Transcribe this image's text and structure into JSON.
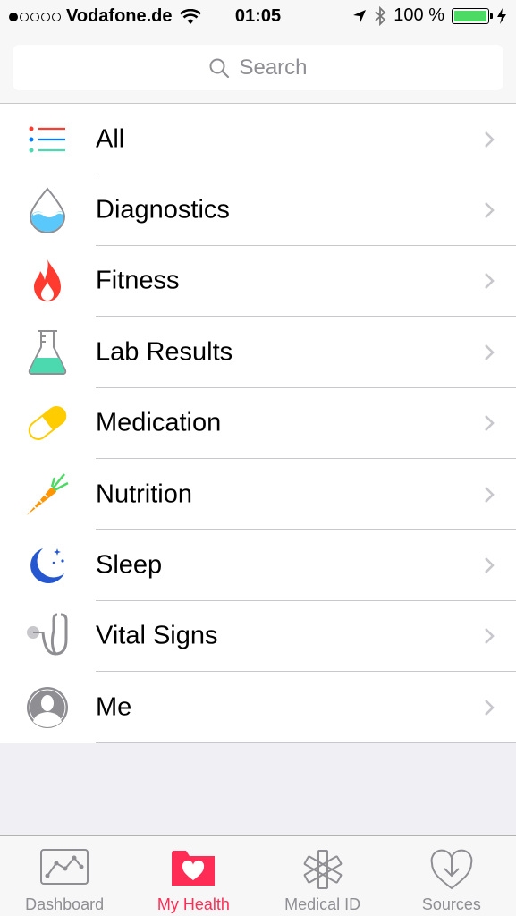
{
  "status_bar": {
    "carrier": "Vodafone.de",
    "time": "01:05",
    "battery_percent": "100 %",
    "signal_bars": 1
  },
  "search": {
    "placeholder": "Search"
  },
  "categories": [
    {
      "label": "All",
      "icon": "list-icon"
    },
    {
      "label": "Diagnostics",
      "icon": "drop-icon"
    },
    {
      "label": "Fitness",
      "icon": "flame-icon"
    },
    {
      "label": "Lab Results",
      "icon": "flask-icon"
    },
    {
      "label": "Medication",
      "icon": "pill-icon"
    },
    {
      "label": "Nutrition",
      "icon": "carrot-icon"
    },
    {
      "label": "Sleep",
      "icon": "moon-icon"
    },
    {
      "label": "Vital Signs",
      "icon": "stethoscope-icon"
    },
    {
      "label": "Me",
      "icon": "profile-icon"
    }
  ],
  "tabs": [
    {
      "label": "Dashboard",
      "icon": "chart-icon",
      "active": false
    },
    {
      "label": "My Health",
      "icon": "heart-folder-icon",
      "active": true
    },
    {
      "label": "Medical ID",
      "icon": "asterisk-icon",
      "active": false
    },
    {
      "label": "Sources",
      "icon": "download-heart-icon",
      "active": false
    }
  ],
  "colors": {
    "accent": "#ff2d55",
    "battery": "#4cd964",
    "separator": "#c8c7cc",
    "background": "#efeff4"
  }
}
